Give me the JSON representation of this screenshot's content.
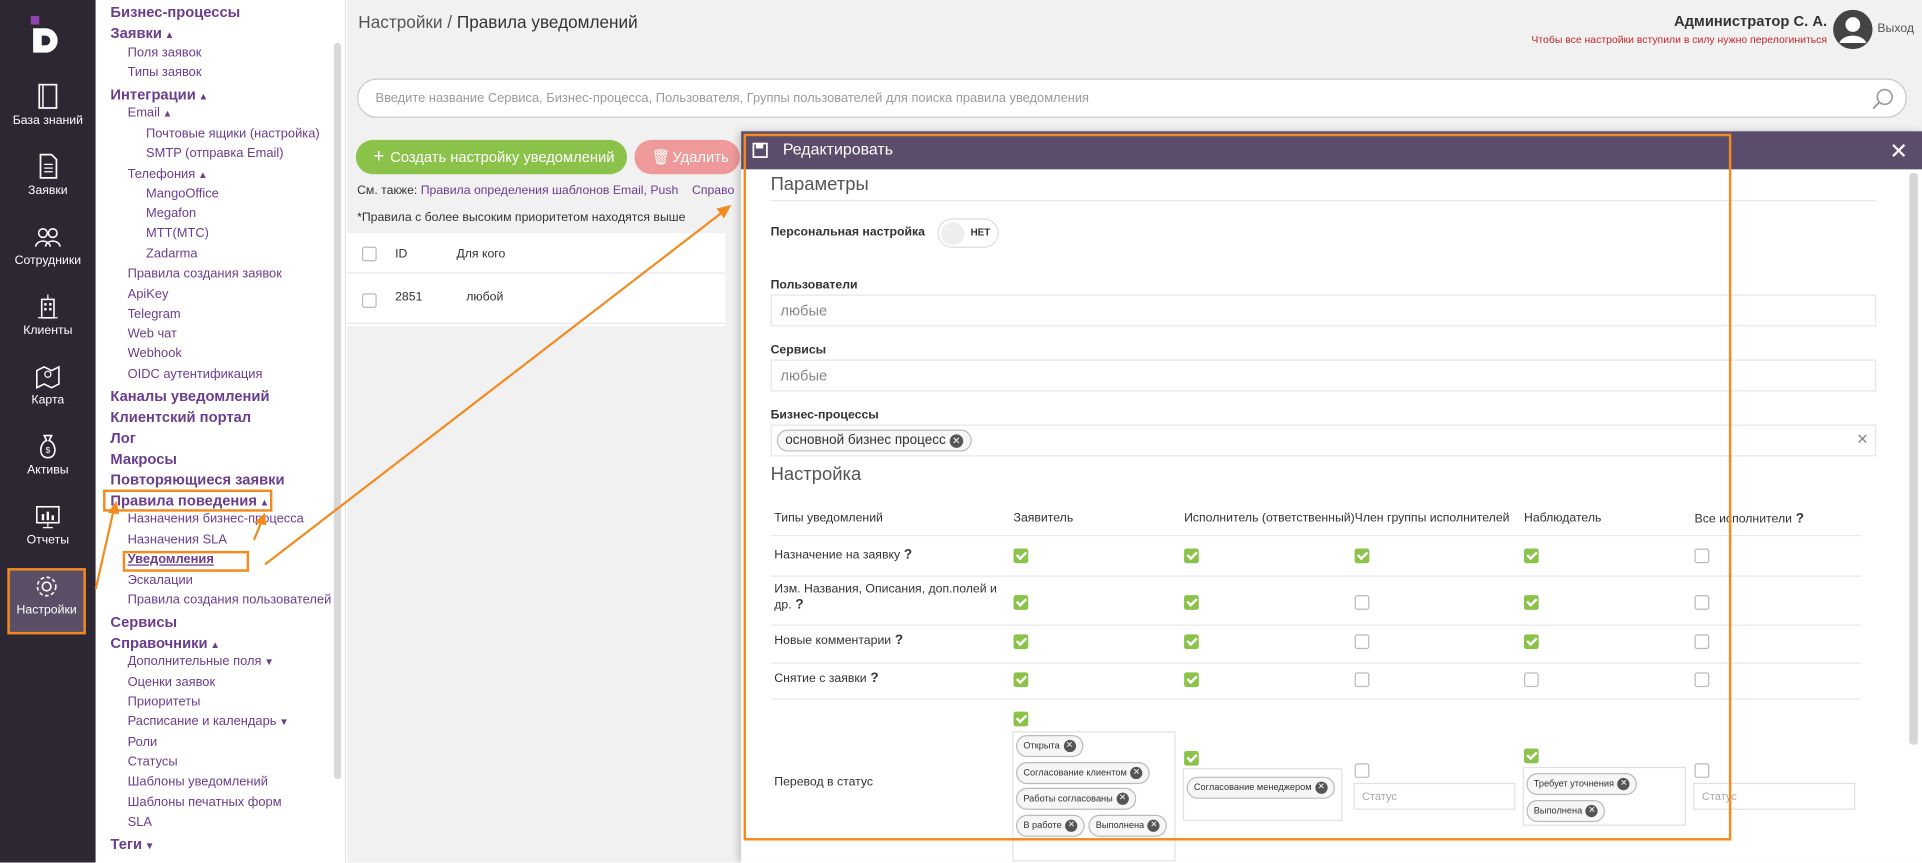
{
  "nav": [
    {
      "label": "База знаний",
      "icon": "book-icon"
    },
    {
      "label": "Заявки",
      "icon": "document-icon"
    },
    {
      "label": "Сотрудники",
      "icon": "people-icon"
    },
    {
      "label": "Клиенты",
      "icon": "building-icon"
    },
    {
      "label": "Карта",
      "icon": "map-icon"
    },
    {
      "label": "Активы",
      "icon": "money-bag-icon"
    },
    {
      "label": "Отчеты",
      "icon": "monitor-chart-icon"
    },
    {
      "label": "Настройки",
      "icon": "gear-icon"
    }
  ],
  "sidebar": {
    "items": [
      "Бизнес-процессы",
      "Заявки",
      "Поля заявок",
      "Типы заявок",
      "Интеграции",
      "Email",
      "Почтовые ящики (настройка)",
      "SMTP (отправка Email)",
      "Телефония",
      "MangoOffice",
      "Megafon",
      "МТТ(МТС)",
      "Zadarma",
      "Правила создания заявок",
      "ApiKey",
      "Telegram",
      "Web чат",
      "Webhook",
      "OIDC аутентификация",
      "Каналы уведомлений",
      "Клиентский портал",
      "Лог",
      "Макросы",
      "Повторяющиеся заявки",
      "Правила поведения",
      "Назначения бизнес-процесса",
      "Назначения SLA",
      "Уведомления",
      "Эскалации",
      "Правила создания пользователей",
      "Сервисы",
      "Справочники",
      "Дополнительные поля",
      "Оценки заявок",
      "Приоритеты",
      "Расписание и календарь",
      "Роли",
      "Статусы",
      "Шаблоны уведомлений",
      "Шаблоны печатных форм",
      "SLA",
      "Теги"
    ]
  },
  "header": {
    "crumb_root": "Настройки",
    "crumb_sep": "/",
    "crumb_page": "Правила уведомлений",
    "user": "Администратор С. А.",
    "warning": "Чтобы все настройки вступили в силу нужно перелогиниться",
    "exit": "Выход"
  },
  "search": {
    "placeholder": "Введите название Сервиса, Бизнес-процесса, Пользователя, Группы пользователей для поиска правила уведомления"
  },
  "toolbar": {
    "create": "Создать настройку уведомлений",
    "delete": "Удалить",
    "see_also": "См. также:",
    "link1": "Правила определения шаблонов Email, Push",
    "link2": "Справо",
    "note": "*Правила с более высоким приоритетом находятся выше"
  },
  "table": {
    "col_id": "ID",
    "col_for": "Для кого",
    "row_id": "2851",
    "row_for": "любой"
  },
  "modal": {
    "title": "Редактировать",
    "params": "Параметры",
    "personal_label": "Персональная настройка",
    "personal_value": "НЕТ",
    "users_label": "Пользователи",
    "users_value": "любые",
    "services_label": "Сервисы",
    "services_value": "любые",
    "bp_label": "Бизнес-процессы",
    "bp_chip": "основной бизнес процесс",
    "settings": "Настройка",
    "headers": [
      "Типы уведомлений",
      "Заявитель",
      "Исполнитель (ответственный)",
      "Член группы исполнителей",
      "Наблюдатель",
      "Все исполнители"
    ],
    "rows": [
      {
        "label": "Назначение на заявку",
        "checks": [
          true,
          true,
          true,
          true,
          false
        ]
      },
      {
        "label": "Изм. Названия, Описания, доп.полей и др.",
        "checks": [
          true,
          true,
          false,
          true,
          false
        ]
      },
      {
        "label": "Новые комментарии",
        "checks": [
          true,
          true,
          false,
          true,
          false
        ]
      },
      {
        "label": "Снятие с заявки",
        "checks": [
          true,
          true,
          false,
          false,
          false
        ]
      }
    ],
    "status_row": {
      "label": "Перевод в статус",
      "applicant_chips": [
        "Открыта",
        "Согласование клиентом",
        "Работы согласованы",
        "В работе",
        "Выполнена"
      ],
      "executor_chips": [
        "Согласование менеджером"
      ],
      "observer_chips": [
        "Требует уточнения",
        "Выполнена"
      ],
      "placeholder": "Статус"
    }
  }
}
